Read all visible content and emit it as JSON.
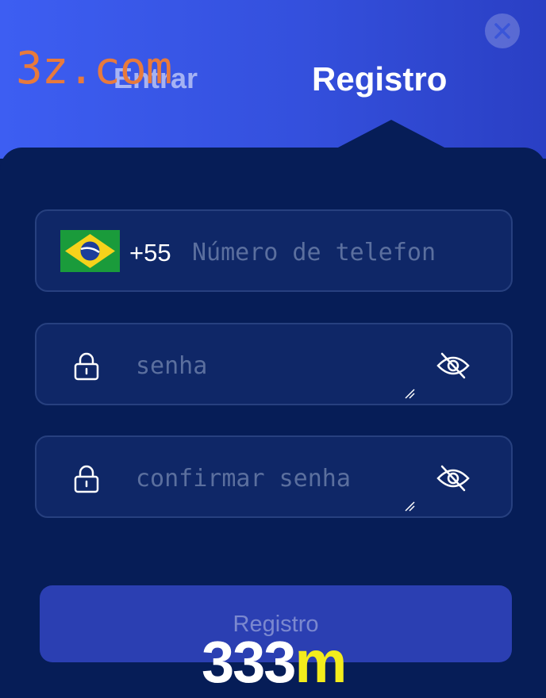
{
  "tabs": {
    "entrar_label": "Entrar",
    "registro_label": "Registro"
  },
  "watermark": "3z.com",
  "phone": {
    "country_code": "+55",
    "placeholder": "Número de telefon",
    "flag": "brazil-flag"
  },
  "password": {
    "placeholder": "senha"
  },
  "confirm_password": {
    "placeholder": "confirmar senha"
  },
  "submit": {
    "label": "Registro"
  },
  "overlay": {
    "part1": "333",
    "part2": "m"
  },
  "colors": {
    "header_start": "#3d5ef2",
    "panel": "#061d57",
    "field_bg": "#0f2767",
    "button": "#2b3fb2",
    "overlay_yellow": "#f3ec1c"
  },
  "icons": [
    "close-icon",
    "lock-icon",
    "eye-off-icon",
    "resize-handle-icon"
  ]
}
